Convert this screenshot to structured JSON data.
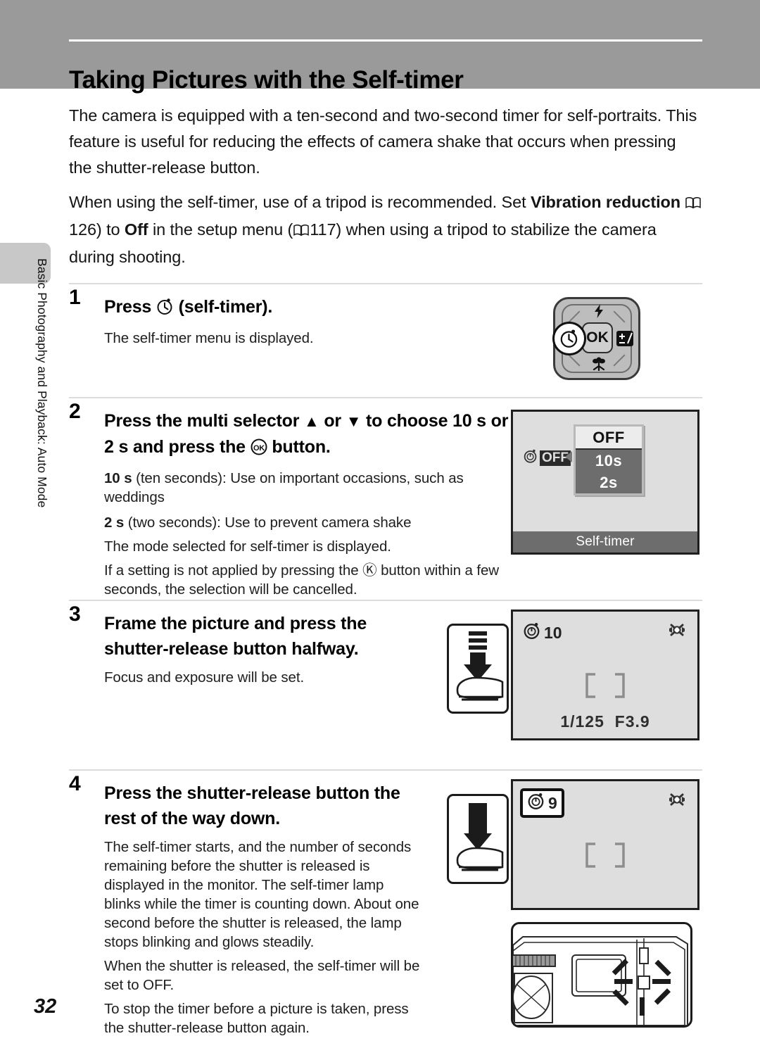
{
  "header": {
    "title": "Taking Pictures with the Self-timer"
  },
  "sidebar": {
    "chapter_label": "Basic Photography and Playback: Auto Mode"
  },
  "intro": {
    "paragraph1": "The camera is equipped with a ten-second and two-second timer for self-portraits. This feature is useful for reducing the effects of camera shake that occurs when pressing the shutter-release button.",
    "p2_part1": "When using the self-timer, use of a tripod is recommended. Set ",
    "p2_bold1": "Vibration reduction",
    "p2_ref1": "126",
    "p2_part2": ") to ",
    "p2_bold2": "Off",
    "p2_part3": " in the setup menu (",
    "p2_ref2": "117",
    "p2_part4": ") when using a tripod to stabilize the camera during shooting."
  },
  "steps": [
    {
      "number": "1",
      "heading_pre": "Press ",
      "heading_icon": "self-timer-icon",
      "heading_post": " (self-timer).",
      "body": [
        "The self-timer menu is displayed."
      ]
    },
    {
      "number": "2",
      "heading_a": "Press the multi selector ",
      "heading_up": "▲",
      "heading_b": " or ",
      "heading_down": "▼",
      "heading_c": " to choose ",
      "heading_bold1": "10 s",
      "heading_d": " or ",
      "heading_bold2": "2 s",
      "heading_e": " and press the ",
      "heading_ok": "OK",
      "heading_f": " button.",
      "body": [
        {
          "bold": "10 s",
          "text": " (ten seconds): Use on important occasions, such as weddings"
        },
        {
          "bold": "2 s",
          "text": " (two seconds): Use to prevent camera shake"
        },
        {
          "bold": "",
          "text": "The mode selected for self-timer is displayed."
        },
        {
          "bold": "",
          "text": "If a setting is not applied by pressing the Ⓚ button within a few seconds, the selection will be cancelled."
        }
      ]
    },
    {
      "number": "3",
      "heading": "Frame the picture and press the shutter-release button halfway.",
      "body": [
        "Focus and exposure will be set."
      ]
    },
    {
      "number": "4",
      "heading": "Press the shutter-release button the rest of the way down.",
      "body": [
        "The self-timer starts, and the number of seconds remaining before the shutter is released is displayed in the monitor. The self-timer lamp blinks while the timer is counting down. About one second before the shutter is released, the lamp stops blinking and glows steadily.",
        "When the shutter is released, the self-timer will be set to OFF.",
        "To stop the timer before a picture is taken, press the shutter-release button again."
      ]
    }
  ],
  "multi_selector": {
    "center_label": "OK",
    "top_icon": "flash-icon",
    "left_icon": "self-timer-icon",
    "right_icon": "exposure-compensation-icon",
    "bottom_icon": "macro-flower-icon",
    "right_glyph": "±"
  },
  "selftimer_menu": {
    "options": [
      "OFF",
      "10s",
      "2s"
    ],
    "selected": "OFF",
    "current_indicator": "OFF",
    "caption": "Self-timer"
  },
  "shooting_display_step3": {
    "selftimer_value": "10",
    "vr_icon": "vibration-reduction-icon",
    "focus_brackets": "[    ]",
    "shutter_speed": "1/125",
    "aperture": "F3.9"
  },
  "shooting_display_step4": {
    "countdown_value": "9",
    "vr_icon": "vibration-reduction-icon",
    "focus_brackets": "[    ]"
  },
  "figures": {
    "press_halfway_label": "press-shutter-halfway-icon",
    "press_full_label": "press-shutter-full-icon",
    "camera_lamp_label": "camera-self-timer-lamp-blinking"
  },
  "page": {
    "number": "32"
  },
  "colors": {
    "header_bg": "#9a9a9a",
    "tab_bg": "#c8c8c8",
    "lcd_bg": "#dedede",
    "menu_bg": "#6d6d6d",
    "separator": "#dcdcdc"
  }
}
